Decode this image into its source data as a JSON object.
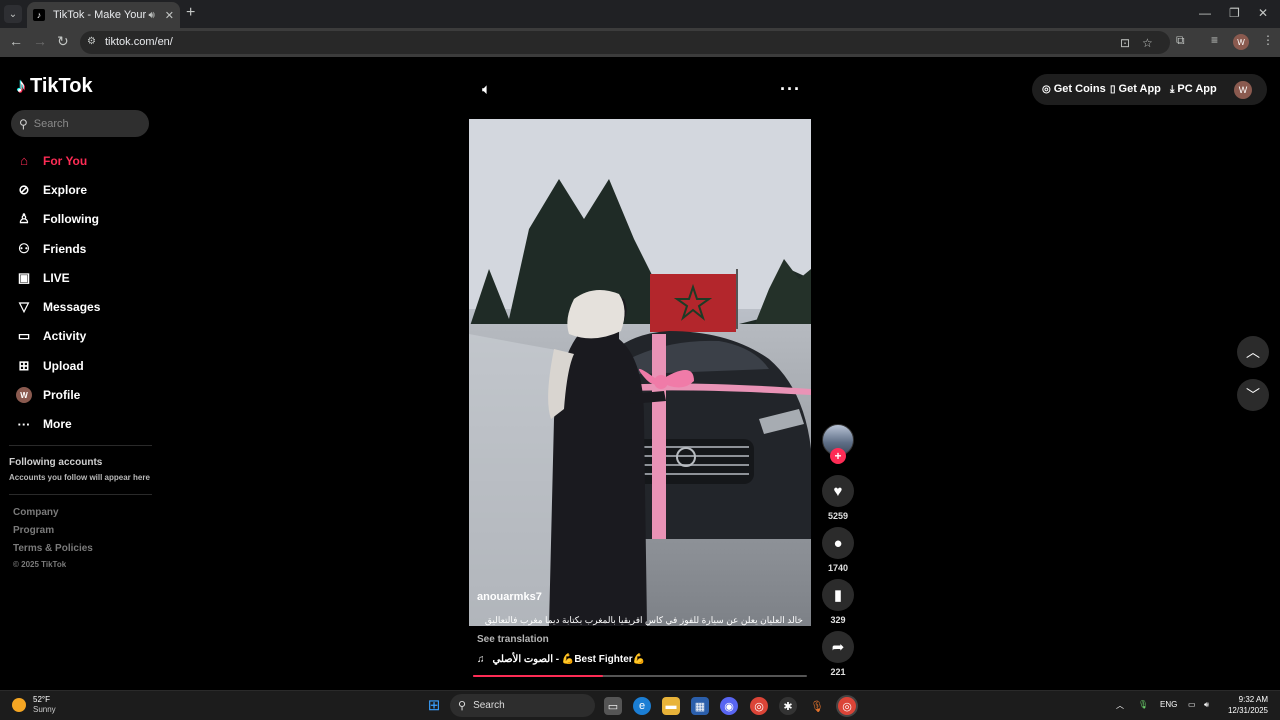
{
  "browser": {
    "tab_title": "TikTok - Make Your Day",
    "url": "tiktok.com/en/"
  },
  "sidebar": {
    "logo": "TikTok",
    "search_placeholder": "Search",
    "nav": [
      {
        "label": "For You",
        "icon": "home-icon"
      },
      {
        "label": "Explore",
        "icon": "compass-icon"
      },
      {
        "label": "Following",
        "icon": "user-icon"
      },
      {
        "label": "Friends",
        "icon": "users-icon"
      },
      {
        "label": "LIVE",
        "icon": "live-icon"
      },
      {
        "label": "Messages",
        "icon": "send-icon"
      },
      {
        "label": "Activity",
        "icon": "message-box-icon"
      },
      {
        "label": "Upload",
        "icon": "upload-icon"
      },
      {
        "label": "Profile",
        "icon": "profile-avatar",
        "avatar_letter": "W"
      },
      {
        "label": "More",
        "icon": "more-icon"
      }
    ],
    "following_title": "Following accounts",
    "following_sub": "Accounts you follow will appear here",
    "footer": [
      "Company",
      "Program",
      "Terms & Policies"
    ],
    "copyright": "© 2025 TikTok"
  },
  "topbar": {
    "get_coins": "Get Coins",
    "get_app": "Get App",
    "pc_app": "PC App",
    "avatar_letter": "W"
  },
  "video": {
    "username": "anouarmks7",
    "caption": "خالد العليان يعلن عن سيارة للفوز في كاس افريقيا بالمغرب بكتابة ديما مغرب فالتعاليق",
    "see_translation": "See translation",
    "music": "الصوت الأصلي - 💪Best Fighter💪",
    "progress": 0.39
  },
  "actions": {
    "likes": "5259",
    "comments": "1740",
    "saves": "329",
    "shares": "221"
  },
  "taskbar": {
    "temp": "52°F",
    "condition": "Sunny",
    "search_label": "Search",
    "lang": "ENG",
    "time": "9:32 AM",
    "date": "12/31/2025"
  },
  "colors": {
    "accent": "#fe2c55",
    "background": "#000000"
  }
}
